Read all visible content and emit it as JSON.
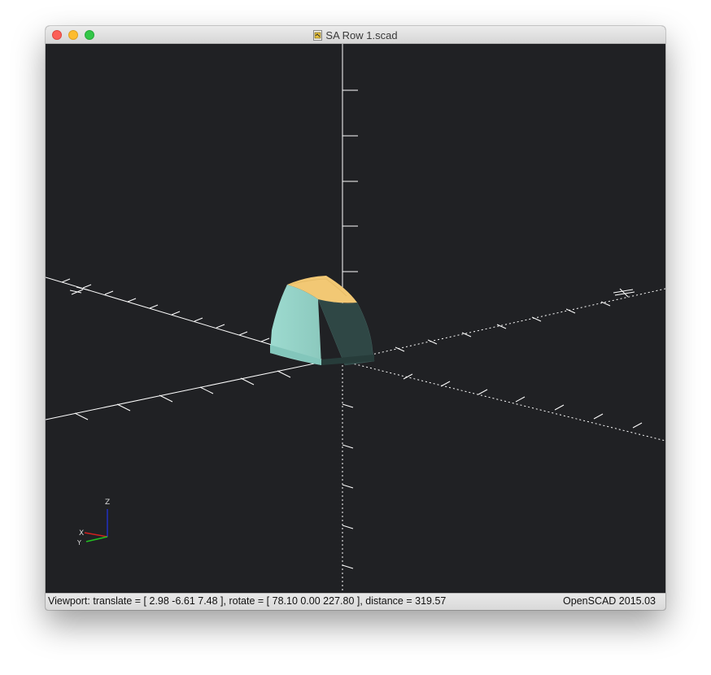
{
  "window": {
    "title": "SA Row 1.scad",
    "file_icon": "scad-document-icon"
  },
  "viewport": {
    "background": "#202124",
    "model_colors": {
      "top": "#f2c874",
      "front": "#96d8cc",
      "side": "#2f4745"
    },
    "axis_indicator": {
      "z_label": "Z",
      "x_label": "X",
      "y_label": "Y",
      "x_color": "#d22020",
      "y_color": "#22c022",
      "z_color": "#2030c0"
    }
  },
  "status": {
    "viewport_text": "Viewport: translate = [ 2.98 -6.61 7.48 ], rotate = [ 78.10 0.00 227.80 ], distance = 319.57",
    "app_version": "OpenSCAD 2015.03"
  }
}
